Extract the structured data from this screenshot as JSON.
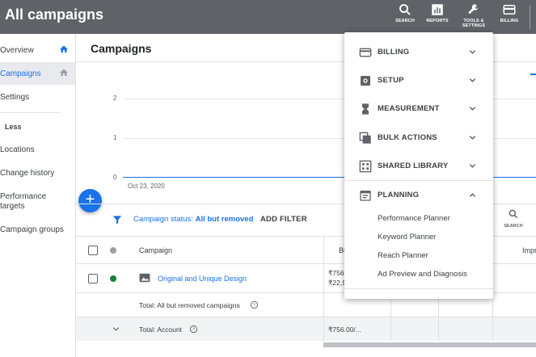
{
  "header": {
    "title": "All campaigns",
    "buttons": [
      {
        "label": "SEARCH",
        "icon": "search-icon"
      },
      {
        "label": "REPORTS",
        "icon": "reports-icon"
      },
      {
        "label": "TOOLS &\nSETTINGS",
        "icon": "wrench-icon"
      },
      {
        "label": "BILLING",
        "icon": "card-icon"
      }
    ]
  },
  "sidebar": {
    "items": [
      {
        "label": "Overview"
      },
      {
        "label": "Campaigns"
      },
      {
        "label": "Settings"
      },
      {
        "label": "Less"
      },
      {
        "label": "Locations"
      },
      {
        "label": "Change history"
      },
      {
        "label": "Performance\ntargets"
      },
      {
        "label": "Campaign groups"
      }
    ]
  },
  "main": {
    "title": "Campaigns",
    "chart": {
      "y_ticks": [
        "2",
        "1",
        "0"
      ],
      "x_tick": "Oct 23, 2020"
    },
    "filter": {
      "prefix": "Campaign status: ",
      "value": "All but removed",
      "add_filter": "ADD FILTER"
    },
    "search_label": "SEARCH",
    "table": {
      "headers": {
        "campaign": "Campaign",
        "budget": "Bu",
        "impr": "Impr"
      },
      "rows": [
        {
          "name": "Original and Unique Design",
          "budget_line1": "₹756",
          "budget_line2": "₹22,9"
        },
        {
          "name": "Total: All but removed campaigns"
        },
        {
          "name": "Total: Account",
          "budget": "₹756.00/..."
        }
      ]
    }
  },
  "menu": {
    "sections": [
      {
        "label": "BILLING",
        "icon": "card-icon"
      },
      {
        "label": "SETUP",
        "icon": "setup-icon"
      },
      {
        "label": "MEASUREMENT",
        "icon": "hourglass-icon"
      },
      {
        "label": "BULK ACTIONS",
        "icon": "copy-icon"
      },
      {
        "label": "SHARED LIBRARY",
        "icon": "library-icon"
      },
      {
        "label": "PLANNING",
        "icon": "calendar-icon"
      }
    ],
    "planning_items": [
      "Performance Planner",
      "Keyword Planner",
      "Reach Planner",
      "Ad Preview and Diagnosis"
    ]
  },
  "colors": {
    "header_bg": "#5f6368",
    "accent": "#1a73e8",
    "enabled_status": "#188038"
  }
}
